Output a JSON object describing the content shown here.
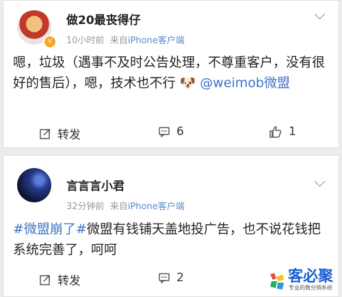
{
  "posts": [
    {
      "username": "做20最丧得仔",
      "time": "10小时前",
      "source_prefix": "来自",
      "source": "iPhone客户端",
      "text_part1": "嗯，垃圾（遇事不及时公告处理，不尊重客户，没有很好的售后），嗯，技术也不行",
      "emoji": "🐶",
      "mention": "@weimob微盟",
      "actions": {
        "repost": "转发",
        "comments": "6",
        "likes": "1"
      }
    },
    {
      "username": "言言言小君",
      "time": "32分钟前",
      "source_prefix": "来自",
      "source": "iPhone客户端",
      "hashtag": "#微盟崩了#",
      "text_part2": "微盟有钱铺天盖地投广告，也不说花钱把系统完善了，呵呵",
      "actions": {
        "repost": "转发",
        "comments": "2"
      }
    }
  ],
  "watermark": {
    "brand": "客必聚",
    "tagline": "专业的微分销系统"
  },
  "colors": {
    "link": "#3b73c7",
    "source": "#5b8bc9",
    "badge": "#f5a623",
    "brand": "#1d5fd0"
  },
  "icons": [
    "repost-icon",
    "comment-icon",
    "like-icon",
    "chevron-down-icon",
    "verified-badge-icon"
  ]
}
